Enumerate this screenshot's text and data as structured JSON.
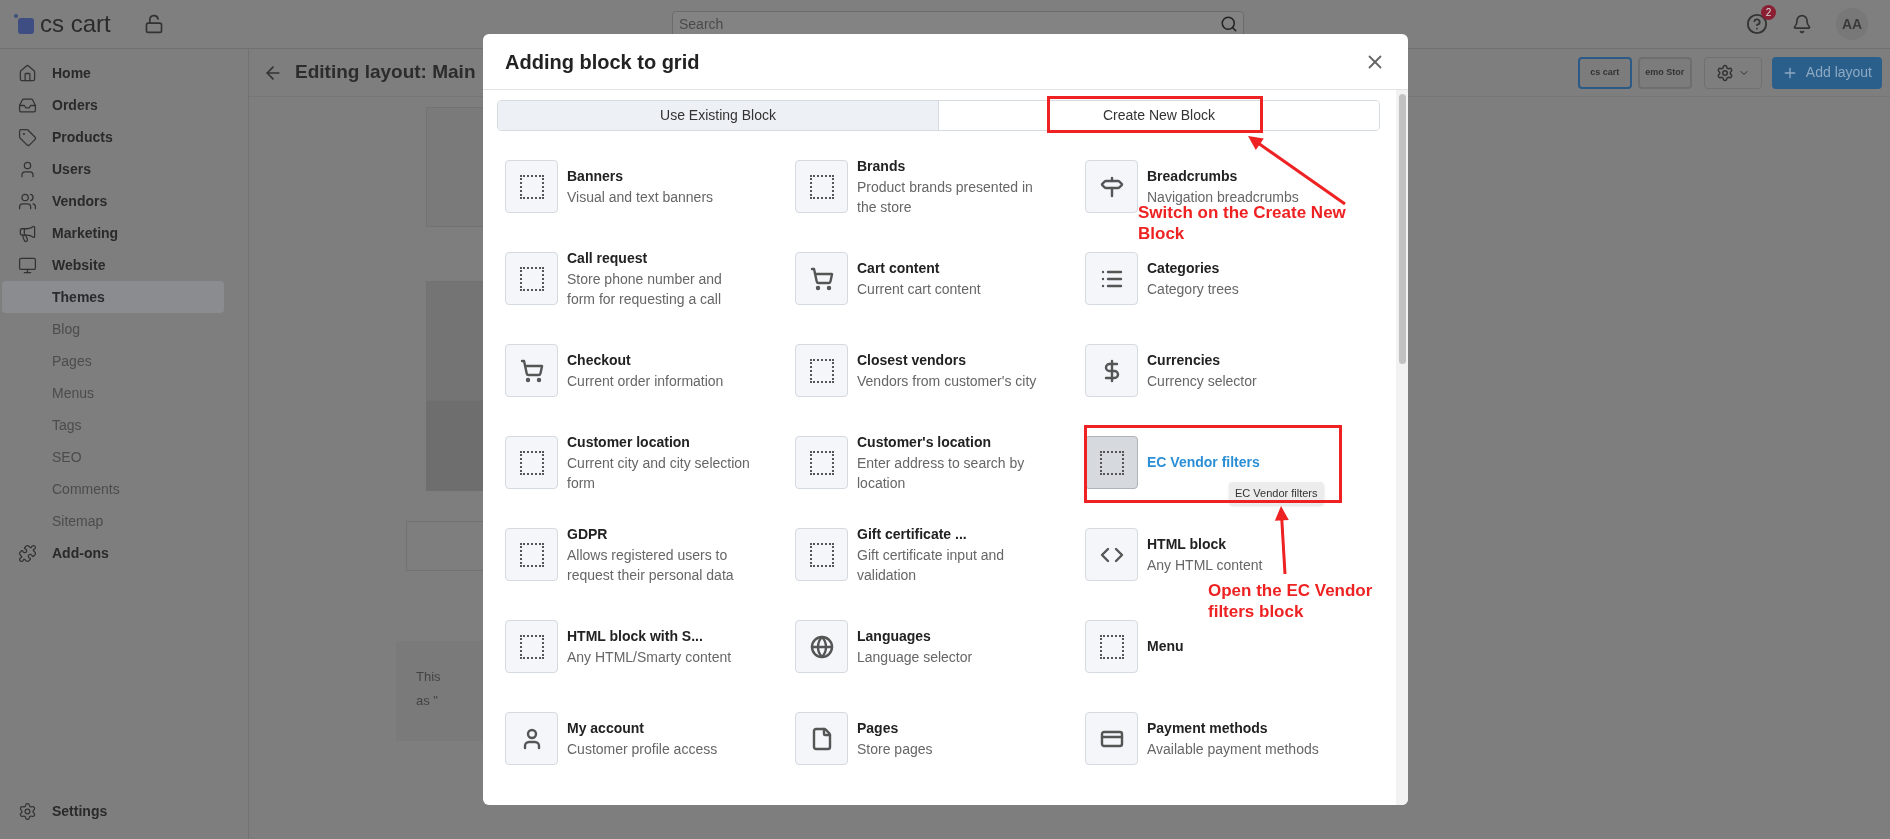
{
  "topbar": {
    "logo": "cs cart",
    "search": {
      "placeholder": "Search"
    },
    "help_badge": "2",
    "avatar": "AA"
  },
  "sidebar": {
    "items": [
      {
        "label": "Home",
        "kind": "home",
        "selected": false
      },
      {
        "label": "Orders",
        "kind": "inbox",
        "selected": false
      },
      {
        "label": "Products",
        "kind": "tag",
        "selected": false
      },
      {
        "label": "Users",
        "kind": "user",
        "selected": false
      },
      {
        "label": "Vendors",
        "kind": "users",
        "selected": false
      },
      {
        "label": "Marketing",
        "kind": "megaphone",
        "selected": false
      },
      {
        "label": "Website",
        "kind": "monitor",
        "selected": false
      },
      {
        "label": "Themes",
        "kind": "sub",
        "selected": true
      },
      {
        "label": "Blog",
        "kind": "sub",
        "selected": false
      },
      {
        "label": "Pages",
        "kind": "sub",
        "selected": false
      },
      {
        "label": "Menus",
        "kind": "sub",
        "selected": false
      },
      {
        "label": "Tags",
        "kind": "sub",
        "selected": false
      },
      {
        "label": "SEO",
        "kind": "sub",
        "selected": false
      },
      {
        "label": "Comments",
        "kind": "sub",
        "selected": false
      },
      {
        "label": "Sitemap",
        "kind": "sub",
        "selected": false
      },
      {
        "label": "Add-ons",
        "kind": "puzzle",
        "selected": false
      }
    ],
    "footer": {
      "label": "Settings"
    }
  },
  "page": {
    "title": "Editing layout: Main",
    "theme_thumbs": [
      {
        "label": "cs cart",
        "selected": true
      },
      {
        "label": "emo Stor",
        "selected": false
      }
    ],
    "add_button": "Add layout",
    "notice_lines": [
      "This",
      "as \""
    ]
  },
  "modal": {
    "title": "Adding block to grid",
    "tabs": [
      {
        "label": "Use Existing Block",
        "selected": false
      },
      {
        "label": "Create New Block",
        "selected": true
      }
    ],
    "blocks": [
      {
        "title": "Banners",
        "description": "Visual and text banners",
        "kind": "dotted",
        "highlighted": false
      },
      {
        "title": "Brands",
        "description": "Product brands presented in the store",
        "kind": "dotted",
        "highlighted": false
      },
      {
        "title": "Breadcrumbs",
        "description": "Navigation breadcrumbs",
        "kind": "signpost",
        "highlighted": false
      },
      {
        "title": "Call request",
        "description": "Store phone number and form for requesting a call",
        "kind": "dotted",
        "highlighted": false
      },
      {
        "title": "Cart content",
        "description": "Current cart content",
        "kind": "cart",
        "highlighted": false
      },
      {
        "title": "Categories",
        "description": "Category trees",
        "kind": "list",
        "highlighted": false
      },
      {
        "title": "Checkout",
        "description": "Current order information",
        "kind": "cart",
        "highlighted": false
      },
      {
        "title": "Closest vendors",
        "description": "Vendors from customer's city",
        "kind": "dotted",
        "highlighted": false
      },
      {
        "title": "Currencies",
        "description": "Currency selector",
        "kind": "dollar",
        "highlighted": false
      },
      {
        "title": "Customer location",
        "description": "Current city and city selection form",
        "kind": "dotted",
        "highlighted": false
      },
      {
        "title": "Customer's location",
        "description": "Enter address to search by location",
        "kind": "dotted",
        "highlighted": false
      },
      {
        "title": "EC Vendor filters",
        "kind": "dotted",
        "highlighted": true,
        "tooltip": "EC Vendor filters"
      },
      {
        "title": "GDPR",
        "description": "Allows registered users to request their personal data",
        "kind": "dotted",
        "highlighted": false
      },
      {
        "title": "Gift certificate ...",
        "description": "Gift certificate input and validation",
        "kind": "dotted",
        "highlighted": false
      },
      {
        "title": "HTML block",
        "description": "Any HTML content",
        "kind": "code",
        "highlighted": false
      },
      {
        "title": "HTML block with S...",
        "description": "Any HTML/Smarty content",
        "kind": "dotted",
        "highlighted": false
      },
      {
        "title": "Languages",
        "description": "Language selector",
        "kind": "globe",
        "highlighted": false
      },
      {
        "title": "Menu",
        "kind": "dotted",
        "highlighted": false
      },
      {
        "title": "My account",
        "description": "Customer profile access",
        "kind": "person",
        "highlighted": false
      },
      {
        "title": "Pages",
        "description": "Store pages",
        "kind": "page",
        "highlighted": false
      },
      {
        "title": "Payment methods",
        "description": "Available payment methods",
        "kind": "card",
        "highlighted": false
      }
    ]
  },
  "annotations": [
    {
      "text": "Switch on the Create New Block"
    },
    {
      "text": "Open the EC Vendor filters block"
    }
  ]
}
